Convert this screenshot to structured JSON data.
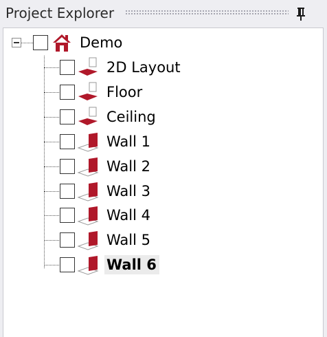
{
  "panel": {
    "title": "Project Explorer",
    "pin_icon": "pin-icon"
  },
  "tree": {
    "root": {
      "label": "Demo",
      "icon": "home-icon",
      "expanded": true,
      "checked": false
    },
    "children": [
      {
        "label": "2D Layout",
        "icon": "layout-plane-icon",
        "checked": false,
        "selected": false
      },
      {
        "label": "Floor",
        "icon": "floor-plane-icon",
        "checked": false,
        "selected": false
      },
      {
        "label": "Ceiling",
        "icon": "ceiling-plane-icon",
        "checked": false,
        "selected": false
      },
      {
        "label": "Wall 1",
        "icon": "wall-icon",
        "checked": false,
        "selected": false
      },
      {
        "label": "Wall 2",
        "icon": "wall-icon",
        "checked": false,
        "selected": false
      },
      {
        "label": "Wall 3",
        "icon": "wall-icon",
        "checked": false,
        "selected": false
      },
      {
        "label": "Wall 4",
        "icon": "wall-icon",
        "checked": false,
        "selected": false
      },
      {
        "label": "Wall 5",
        "icon": "wall-icon",
        "checked": false,
        "selected": false
      },
      {
        "label": "Wall 6",
        "icon": "wall-icon",
        "checked": false,
        "selected": true
      }
    ]
  },
  "colors": {
    "accent_red": "#b0182a",
    "titlebar_bg": "#eeeef2",
    "selection_bg": "#ebebeb"
  }
}
